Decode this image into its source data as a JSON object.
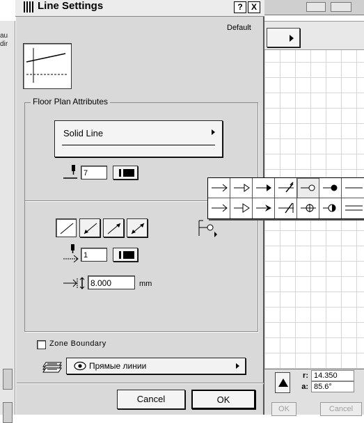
{
  "dialog": {
    "title": "Line Settings",
    "help_label": "?",
    "close_label": "X",
    "preset_label": "Default"
  },
  "floor_plan": {
    "legend": "Floor Plan Attributes",
    "line_type": "Solid Line",
    "pen_number": "7"
  },
  "arrowhead": {
    "pen_number": "1",
    "size_value": "8.000",
    "size_unit": "mm",
    "end_buttons": [
      "no-end-marker",
      "start-marker",
      "end-marker",
      "both-end-marker"
    ],
    "selected_end_button": 0
  },
  "zone_boundary": {
    "label": "Zone Boundary",
    "checked": false
  },
  "layer": {
    "name": "Прямые линии"
  },
  "buttons": {
    "cancel": "Cancel",
    "ok": "OK"
  },
  "palette": {
    "selected_index": 4,
    "row1": [
      "arrow-open-icon",
      "arrow-triangle-open-icon",
      "arrow-filled-icon",
      "tick-slash-icon",
      "circle-open-icon",
      "circle-filled-icon",
      "dash-icon"
    ],
    "row2": [
      "arrow-line-icon",
      "arrow-triangle-hollow-icon",
      "arrow-filled-notched-icon",
      "tick-slash-bar-icon",
      "circle-cross-icon",
      "circle-half-icon",
      "bar-icon"
    ]
  },
  "background": {
    "radius_label": "r:",
    "radius_value": "14.350",
    "angle_label": "a:",
    "angle_value": "85.6°",
    "ok": "OK",
    "cancel": "Cancel",
    "left_label_1": "au",
    "left_label_2": "dir"
  },
  "colors": {
    "dialog_bg": "#d9d9d9",
    "button_bg": "#f4f4f4",
    "border": "#222222"
  }
}
